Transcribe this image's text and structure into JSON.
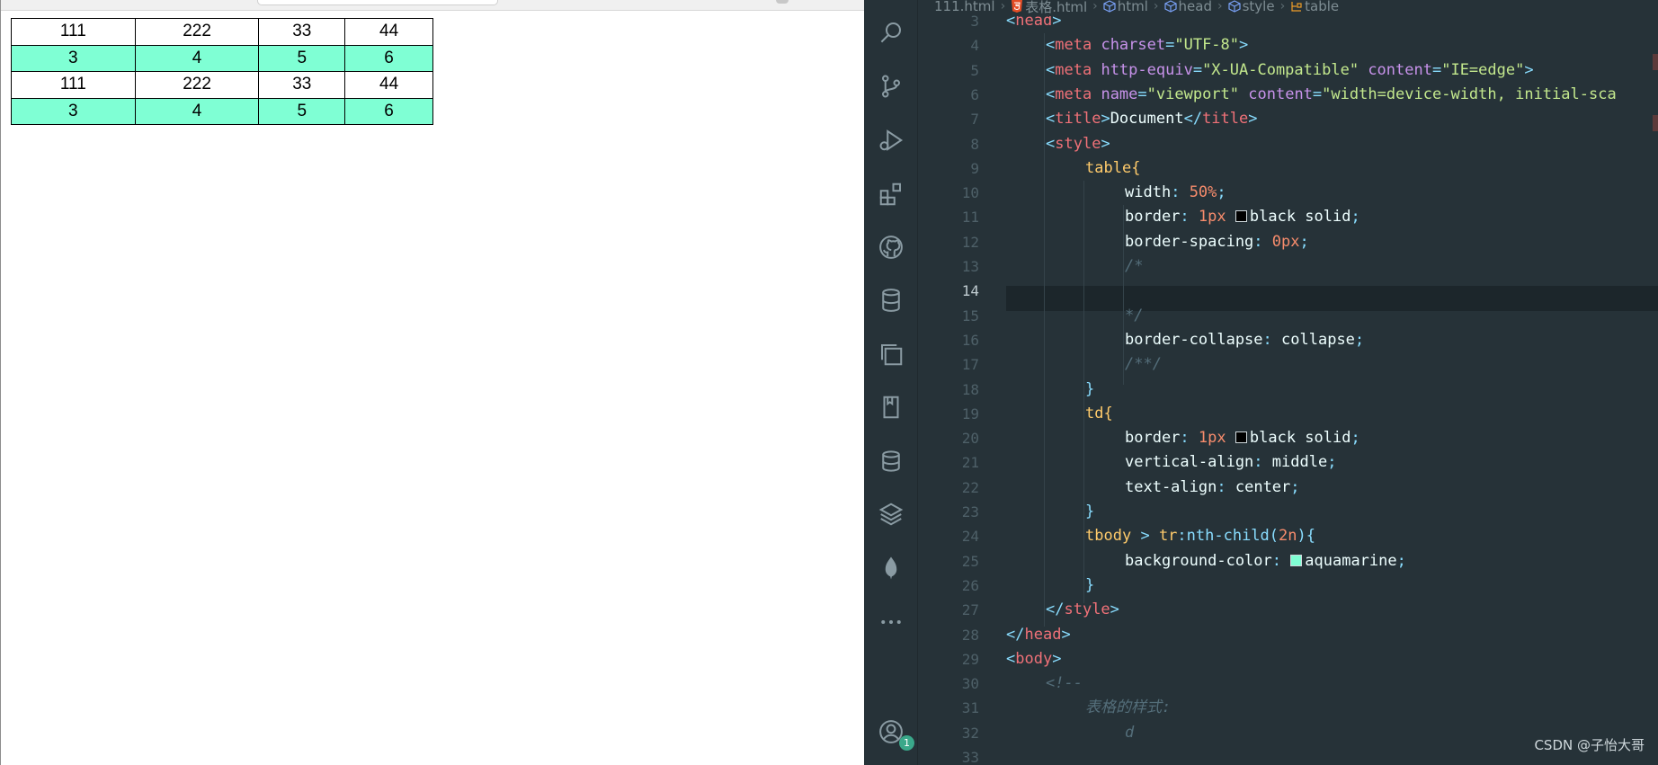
{
  "preview": {
    "rows": [
      [
        "111",
        "222",
        "33",
        "44"
      ],
      [
        "3",
        "4",
        "5",
        "6"
      ],
      [
        "111",
        "222",
        "33",
        "44"
      ],
      [
        "3",
        "4",
        "5",
        "6"
      ]
    ],
    "even_row_color": "#7fffd4"
  },
  "editor": {
    "breadcrumb": [
      "111.html",
      "表格.html",
      "html",
      "head",
      "style",
      "table"
    ],
    "line_numbers": [
      "3",
      "4",
      "5",
      "6",
      "7",
      "8",
      "9",
      "10",
      "11",
      "12",
      "13",
      "14",
      "15",
      "16",
      "17",
      "18",
      "19",
      "20",
      "21",
      "22",
      "23",
      "24",
      "25",
      "26",
      "27",
      "28",
      "29",
      "30",
      "31",
      "32",
      "33"
    ],
    "active_line": "14",
    "code": {
      "l3_tag": "head",
      "l4_tag": "meta",
      "l4_attr": "charset",
      "l4_val": "\"UTF-8\"",
      "l5_tag": "meta",
      "l5_attr1": "http-equiv",
      "l5_val1": "\"X-UA-Compatible\"",
      "l5_attr2": "content",
      "l5_val2": "\"IE=edge\"",
      "l6_tag": "meta",
      "l6_attr1": "name",
      "l6_val1": "\"viewport\"",
      "l6_attr2": "content",
      "l6_val2": "\"width=device-width, initial-sca",
      "l7_tag": "title",
      "l7_text": "Document",
      "l8_tag": "style",
      "l9_sel": "table",
      "l10_prop": "width",
      "l10_val": "50%",
      "l11_prop": "border",
      "l11_num": "1px",
      "l11_rest": "black solid",
      "l12_prop": "border-spacing",
      "l12_val": "0px",
      "l13_cm": "/*",
      "l15_cm": "*/",
      "l16_prop": "border-collapse",
      "l16_val": "collapse",
      "l17_cm": "/**/",
      "l19_sel": "td",
      "l20_prop": "border",
      "l20_num": "1px",
      "l20_rest": "black solid",
      "l21_prop": "vertical-align",
      "l21_val": "middle",
      "l22_prop": "text-align",
      "l22_val": "center",
      "l24_sel1": "tbody",
      "l24_op": ">",
      "l24_sel2": "tr",
      "l24_pseudo": ":nth-child(",
      "l24_arg": "2n",
      "l25_prop": "background-color",
      "l25_val": "aquamarine",
      "l27_tag": "style",
      "l28_tag": "head",
      "l29_tag": "body",
      "l30_cm": "<!--",
      "l31_cm": "表格的样式:",
      "l32_cm": "d"
    },
    "swatch_black": "#000000",
    "swatch_aquamarine": "#7fffd4",
    "accounts_badge": "1"
  },
  "activity_icons": [
    "search-icon",
    "source-control-icon",
    "run-debug-icon",
    "extensions-icon",
    "github-icon",
    "database-icon",
    "remote-explorer-icon",
    "bookmark-icon",
    "database-2-icon",
    "layers-icon",
    "mongodb-leaf-icon",
    "more-icon",
    "accounts-icon"
  ],
  "watermark": "CSDN @子怡大哥"
}
